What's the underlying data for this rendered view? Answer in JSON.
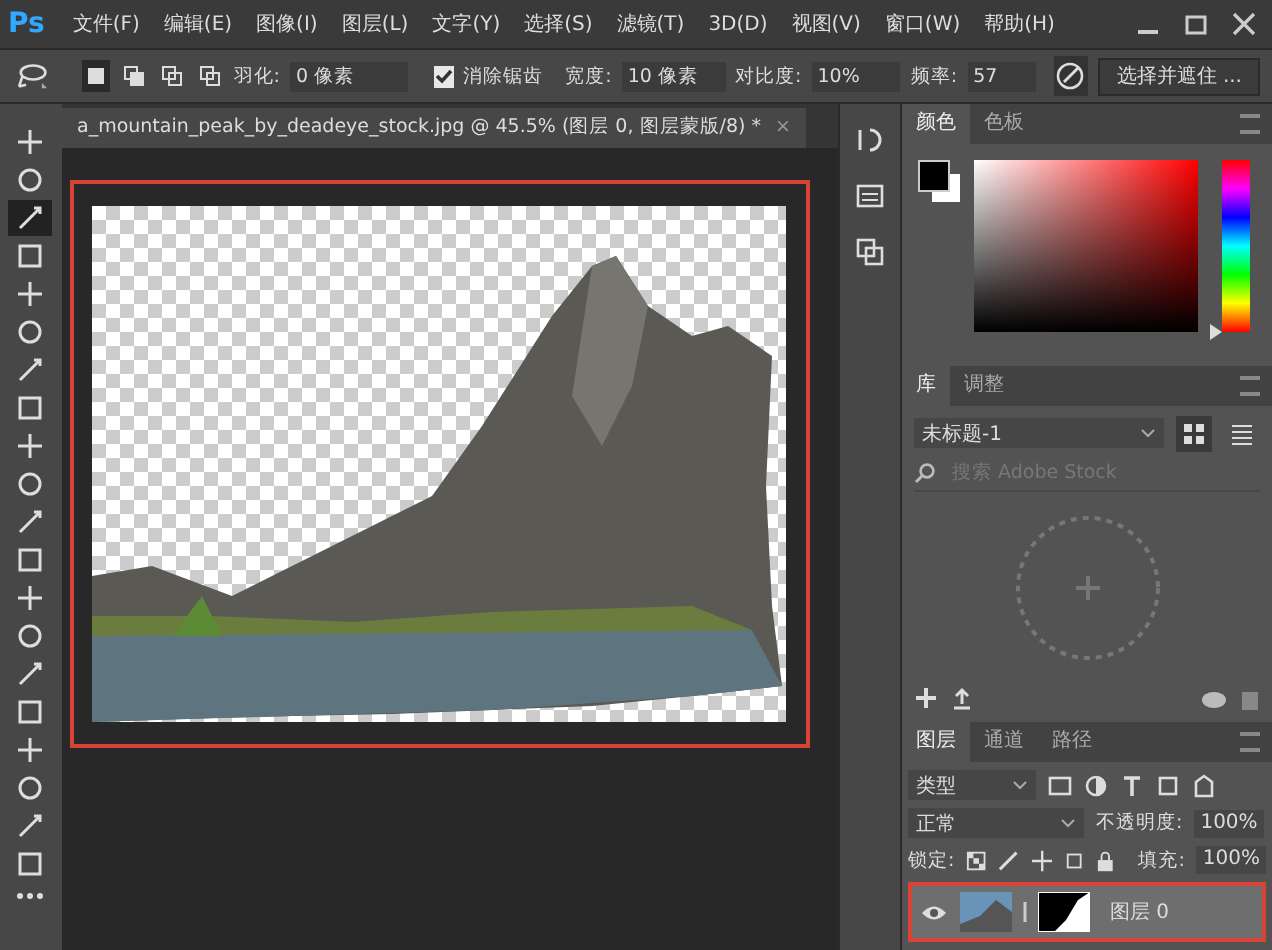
{
  "menu_bar": {
    "logo": "Ps",
    "items": [
      "文件(F)",
      "编辑(E)",
      "图像(I)",
      "图层(L)",
      "文字(Y)",
      "选择(S)",
      "滤镜(T)",
      "3D(D)",
      "视图(V)",
      "窗口(W)",
      "帮助(H)"
    ]
  },
  "options_bar": {
    "modes": [
      {
        "selected": true
      },
      {
        "selected": false
      },
      {
        "selected": false
      },
      {
        "selected": false
      }
    ],
    "feather_label": "羽化:",
    "feather_value": "0 像素",
    "antialias": {
      "label": "消除锯齿",
      "checked": true
    },
    "width_label": "宽度:",
    "width_value": "10 像素",
    "contrast_label": "对比度:",
    "contrast_value": "10%",
    "frequency_label": "频率:",
    "frequency_value": "57",
    "select_mask_button": "选择并遮住 ..."
  },
  "tools": [
    {
      "selected": false
    },
    {
      "selected": false
    },
    {
      "selected": true
    },
    {
      "selected": false
    },
    {
      "selected": false
    },
    {
      "selected": false
    },
    {
      "selected": false
    },
    {
      "selected": false
    },
    {
      "selected": false
    },
    {
      "selected": false
    },
    {
      "selected": false
    },
    {
      "selected": false
    },
    {
      "selected": false
    },
    {
      "selected": false
    },
    {
      "selected": false
    },
    {
      "selected": false
    },
    {
      "selected": false
    },
    {
      "selected": false
    },
    {
      "selected": false
    },
    {
      "selected": false
    }
  ],
  "document_tab": {
    "title": "a_mountain_peak_by_deadeye_stock.jpg @ 45.5% (图层 0, 图层蒙版/8) *",
    "close": "×"
  },
  "color_panel": {
    "tabs": [
      {
        "label": "颜色",
        "selected": true
      },
      {
        "label": "色板",
        "selected": false
      }
    ],
    "hue": {
      "level": 0
    }
  },
  "library_panel": {
    "tabs": [
      {
        "label": "库",
        "selected": true
      },
      {
        "label": "调整",
        "selected": false
      }
    ],
    "library": "未标题-1",
    "search_placeholder": "搜索 Adobe Stock"
  },
  "layers_panel": {
    "tabs": [
      {
        "label": "图层",
        "selected": true
      },
      {
        "label": "通道",
        "selected": false
      },
      {
        "label": "路径",
        "selected": false
      }
    ],
    "filter": "类型",
    "blend_mode": "正常",
    "opacity_label": "不透明度:",
    "opacity": "100%",
    "lock_label": "锁定:",
    "fill_label": "填充:",
    "fill": "100%",
    "layers": [
      {
        "name": "图层 0",
        "visible": true,
        "selected": true
      }
    ]
  }
}
